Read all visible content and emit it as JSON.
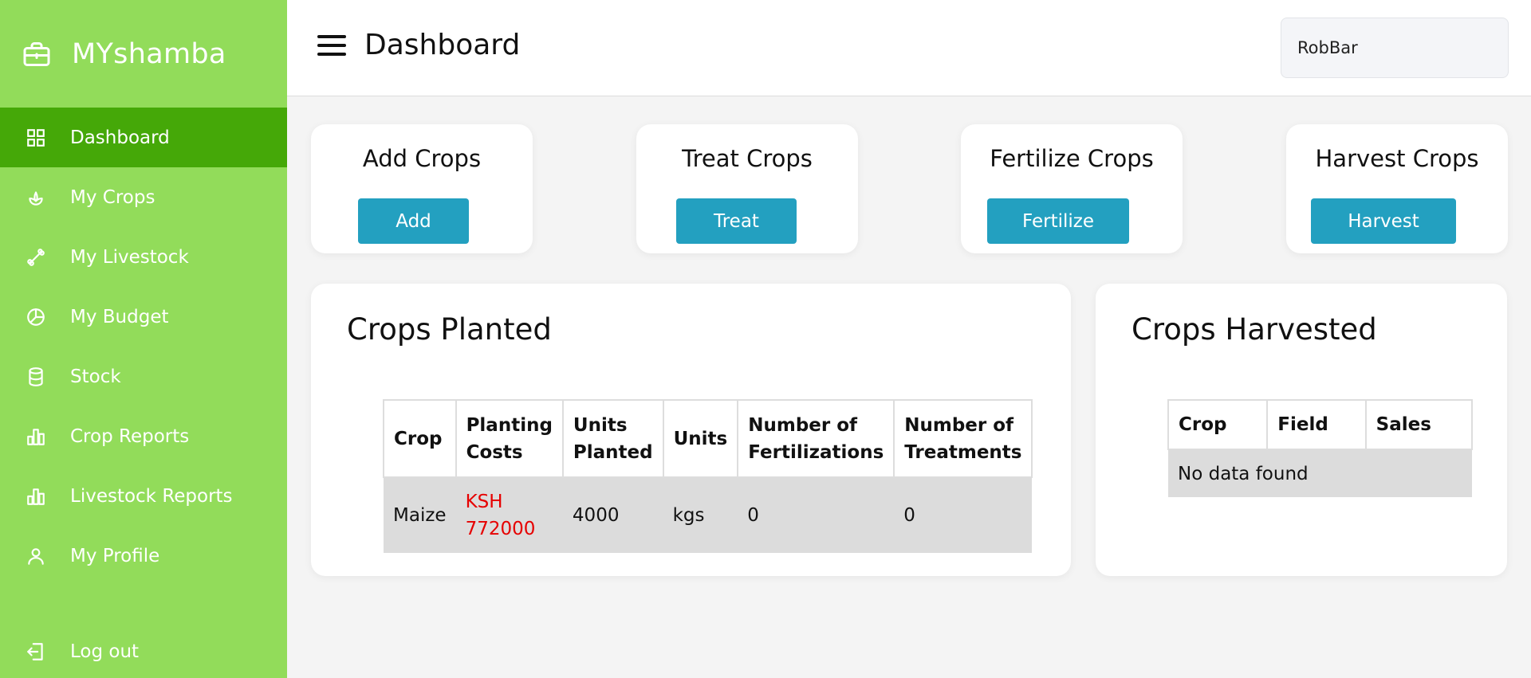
{
  "brand": {
    "name": "MYshamba",
    "icon": "briefcase-icon"
  },
  "sidebar": {
    "items": [
      {
        "label": "Dashboard",
        "icon": "grid-icon",
        "active": true
      },
      {
        "label": "My Crops",
        "icon": "sprout-icon"
      },
      {
        "label": "My Livestock",
        "icon": "bone-icon"
      },
      {
        "label": "My Budget",
        "icon": "pie-chart-icon"
      },
      {
        "label": "Stock",
        "icon": "database-icon"
      },
      {
        "label": "Crop Reports",
        "icon": "bar-chart-icon"
      },
      {
        "label": "Livestock Reports",
        "icon": "bar-chart-icon"
      },
      {
        "label": "My Profile",
        "icon": "user-icon"
      }
    ],
    "logout": {
      "label": "Log out",
      "icon": "logout-icon"
    }
  },
  "header": {
    "title": "Dashboard",
    "username": "RobBar",
    "menu_icon": "hamburger-menu-icon"
  },
  "cards": [
    {
      "title": "Add Crops",
      "button": "Add"
    },
    {
      "title": "Treat Crops",
      "button": "Treat"
    },
    {
      "title": "Fertilize Crops",
      "button": "Fertilize"
    },
    {
      "title": "Harvest Crops",
      "button": "Harvest"
    }
  ],
  "crops_planted": {
    "title": "Crops Planted",
    "columns": [
      "Crop",
      "Planting Costs",
      "Units Planted",
      "Units",
      "Number of Fertilizations",
      "Number of Treatments"
    ],
    "rows": [
      {
        "crop": "Maize",
        "cost": "KSH 772000",
        "units_planted": "4000",
        "units": "kgs",
        "fertilizations": "0",
        "treatments": "0"
      }
    ]
  },
  "crops_harvested": {
    "title": "Crops Harvested",
    "columns": [
      "Crop",
      "Field",
      "Sales"
    ],
    "empty": "No data found"
  },
  "colors": {
    "sidebar": "#92dc5a",
    "active": "#45a808",
    "button": "#23a0c0",
    "cost": "#e60000"
  }
}
